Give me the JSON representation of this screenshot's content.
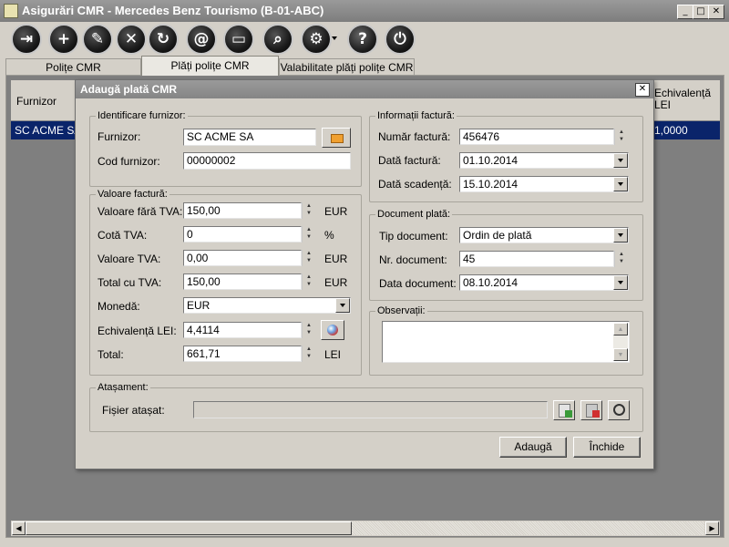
{
  "window": {
    "title": "Asigurări CMR - Mercedes Benz Tourismo (B-01-ABC)"
  },
  "toolbar": {
    "buttons": [
      {
        "icon": "exit-icon",
        "glyph": "⇥"
      },
      {
        "icon": "add-icon",
        "glyph": "+"
      },
      {
        "icon": "edit-icon",
        "glyph": "✎"
      },
      {
        "icon": "delete-icon",
        "glyph": "✕"
      },
      {
        "icon": "refresh-icon",
        "glyph": "↻"
      },
      {
        "icon": "email-icon",
        "glyph": "@"
      },
      {
        "icon": "print-icon",
        "glyph": "▭"
      },
      {
        "icon": "search-icon",
        "glyph": "⌕"
      },
      {
        "icon": "settings-icon",
        "glyph": "⚙"
      },
      {
        "icon": "help-icon",
        "glyph": "?"
      },
      {
        "icon": "power-icon",
        "glyph": "⏻"
      }
    ]
  },
  "tabs": [
    "Polițe CMR",
    "Plăți polițe CMR",
    "Valabilitate plăți polițe CMR"
  ],
  "grid": {
    "col_furnizor": "Furnizor",
    "col_echiv": "Echivalență LEI",
    "row_furnizor": "SC ACME SA",
    "row_echiv": "1,0000"
  },
  "dialog": {
    "title": "Adaugă plată CMR",
    "close_glyph": "✕",
    "supplier": {
      "legend": "Identificare furnizor:",
      "furnizor_label": "Furnizor:",
      "furnizor_value": "SC ACME SA",
      "cod_label": "Cod furnizor:",
      "cod_value": "00000002"
    },
    "invoice_value": {
      "legend": "Valoare factură:",
      "fara_tva_label": "Valoare fără TVA:",
      "fara_tva_value": "150,00",
      "fara_tva_unit": "EUR",
      "cota_label": "Cotă TVA:",
      "cota_value": "0",
      "cota_unit": "%",
      "tva_label": "Valoare TVA:",
      "tva_value": "0,00",
      "tva_unit": "EUR",
      "total_tva_label": "Total cu TVA:",
      "total_tva_value": "150,00",
      "total_tva_unit": "EUR",
      "moneda_label": "Monedă:",
      "moneda_value": "EUR",
      "echiv_label": "Echivalență LEI:",
      "echiv_value": "4,4114",
      "total_label": "Total:",
      "total_value": "661,71",
      "total_unit": "LEI"
    },
    "invoice_info": {
      "legend": "Informații factură:",
      "numar_label": "Număr factură:",
      "numar_value": "456476",
      "data_label": "Dată factură:",
      "data_value": "01.10.2014",
      "scadenta_label": "Dată scadență:",
      "scadenta_value": "15.10.2014"
    },
    "payment_doc": {
      "legend": "Document plată:",
      "tip_label": "Tip document:",
      "tip_value": "Ordin de plată",
      "nr_label": "Nr. document:",
      "nr_value": "45",
      "data_label": "Data document:",
      "data_value": "08.10.2014"
    },
    "notes": {
      "legend": "Observații:",
      "value": ""
    },
    "attachment": {
      "legend": "Atașament:",
      "file_label": "Fișier atașat:",
      "file_value": ""
    },
    "add_button": "Adaugă",
    "close_button": "Închide"
  },
  "colors": {
    "selection": "#0a246a",
    "titlebar": "#8a8a8a",
    "face": "#d4d0c8"
  }
}
